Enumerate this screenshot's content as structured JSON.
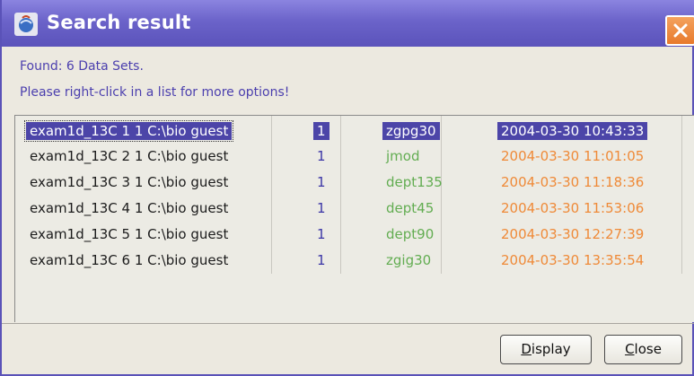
{
  "window": {
    "title": "Search result",
    "icon": "java-app-icon",
    "close_icon": "close-icon"
  },
  "info": {
    "found": "Found: 6 Data Sets.",
    "hint": "Please right-click in a list for more options!"
  },
  "columns": [
    "name",
    "expno",
    "pulse_program",
    "date"
  ],
  "rows": [
    {
      "name": "exam1d_13C  1  1  C:\\bio  guest",
      "expno": "1",
      "pulse": "zgpg30",
      "date": "2004-03-30 10:43:33",
      "selected": true
    },
    {
      "name": "exam1d_13C  2  1  C:\\bio  guest",
      "expno": "1",
      "pulse": "jmod",
      "date": "2004-03-30 11:01:05",
      "selected": false
    },
    {
      "name": "exam1d_13C  3  1  C:\\bio  guest",
      "expno": "1",
      "pulse": "dept135",
      "date": "2004-03-30 11:18:36",
      "selected": false
    },
    {
      "name": "exam1d_13C  4  1  C:\\bio  guest",
      "expno": "1",
      "pulse": "dept45",
      "date": "2004-03-30 11:53:06",
      "selected": false
    },
    {
      "name": "exam1d_13C  5  1  C:\\bio  guest",
      "expno": "1",
      "pulse": "dept90",
      "date": "2004-03-30 12:27:39",
      "selected": false
    },
    {
      "name": "exam1d_13C  6  1  C:\\bio  guest",
      "expno": "1",
      "pulse": "zgig30",
      "date": "2004-03-30 13:35:54",
      "selected": false
    }
  ],
  "buttons": {
    "display_mnemonic": "D",
    "display_rest": "isplay",
    "close_mnemonic": "C",
    "close_rest": "lose"
  },
  "colors": {
    "titlebar": "#6b63c9",
    "selection": "#4c45a8",
    "info_text": "#4b3fae",
    "pulse_text": "#63ad52",
    "date_text": "#ef8a38",
    "close_button": "#e87a2c"
  }
}
